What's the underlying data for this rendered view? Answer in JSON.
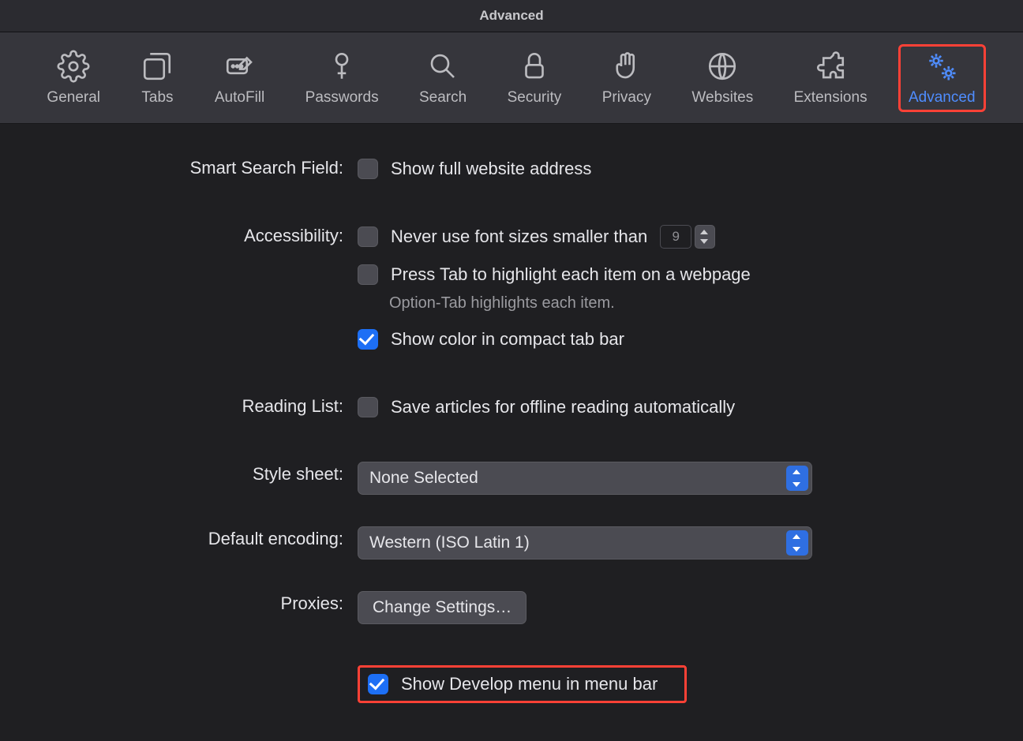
{
  "window": {
    "title": "Advanced"
  },
  "toolbar": {
    "items": [
      {
        "label": "General"
      },
      {
        "label": "Tabs"
      },
      {
        "label": "AutoFill"
      },
      {
        "label": "Passwords"
      },
      {
        "label": "Search"
      },
      {
        "label": "Security"
      },
      {
        "label": "Privacy"
      },
      {
        "label": "Websites"
      },
      {
        "label": "Extensions"
      },
      {
        "label": "Advanced"
      }
    ],
    "active_index": 9
  },
  "sections": {
    "smart_search": {
      "label": "Smart Search Field:",
      "show_full_address": {
        "label": "Show full website address",
        "checked": false
      }
    },
    "accessibility": {
      "label": "Accessibility:",
      "min_font": {
        "label": "Never use font sizes smaller than",
        "checked": false,
        "value": "9"
      },
      "press_tab": {
        "label": "Press Tab to highlight each item on a webpage",
        "checked": false
      },
      "press_tab_hint": "Option-Tab highlights each item.",
      "compact_color": {
        "label": "Show color in compact tab bar",
        "checked": true
      }
    },
    "reading_list": {
      "label": "Reading List:",
      "save_offline": {
        "label": "Save articles for offline reading automatically",
        "checked": false
      }
    },
    "style_sheet": {
      "label": "Style sheet:",
      "value": "None Selected"
    },
    "default_encoding": {
      "label": "Default encoding:",
      "value": "Western (ISO Latin 1)"
    },
    "proxies": {
      "label": "Proxies:",
      "button": "Change Settings…"
    },
    "develop": {
      "label": "Show Develop menu in menu bar",
      "checked": true
    }
  }
}
